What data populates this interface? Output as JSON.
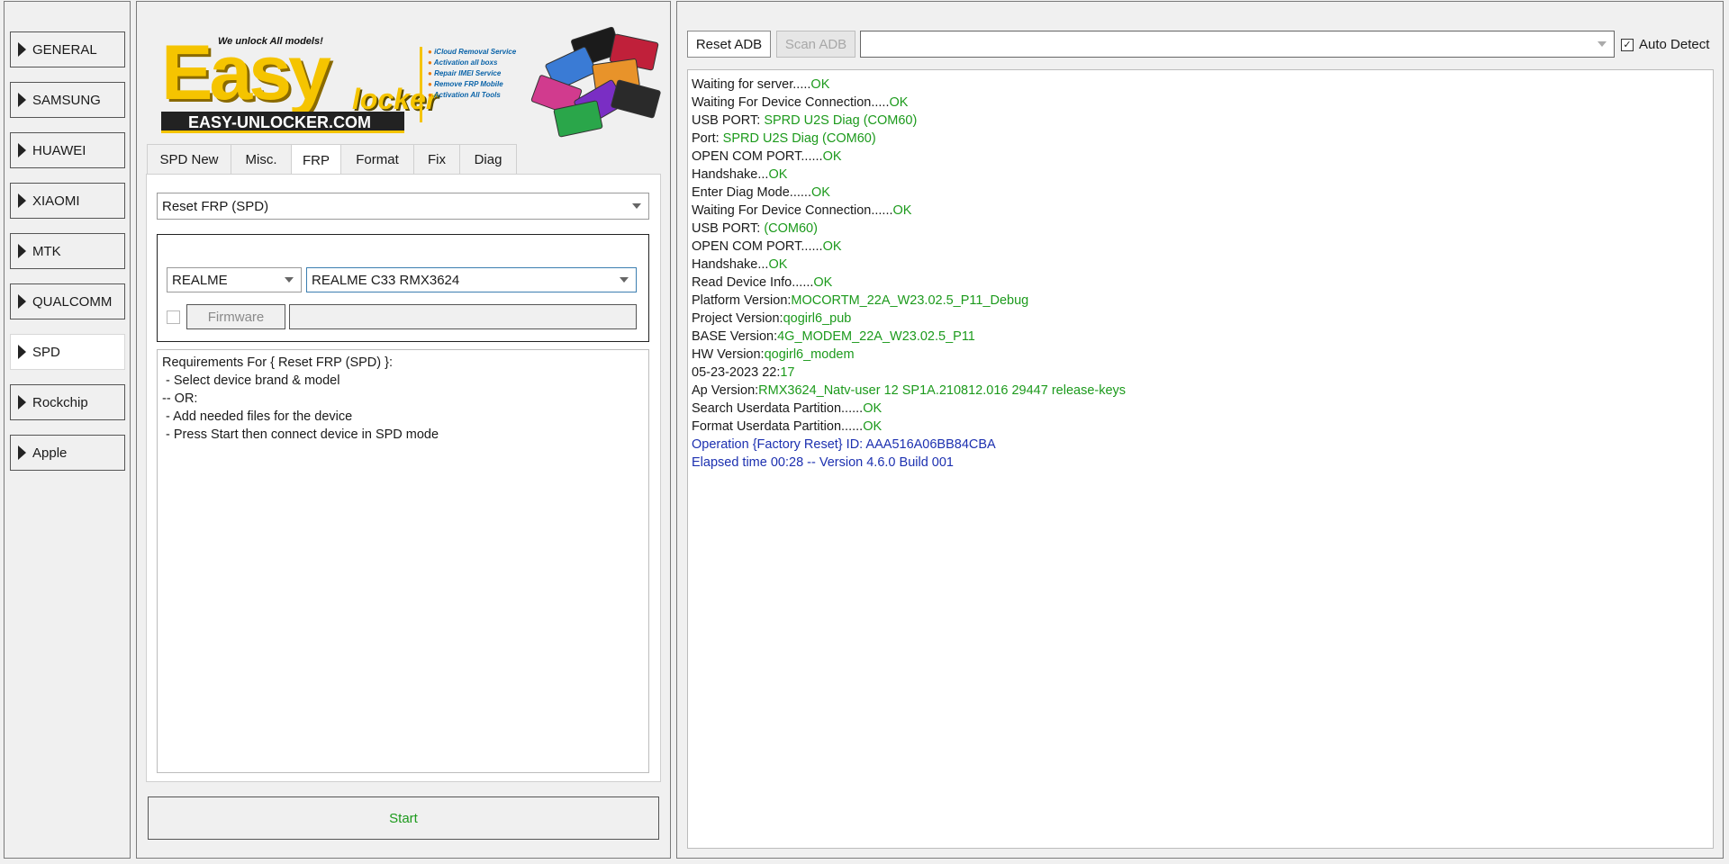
{
  "nav": {
    "items": [
      {
        "label": "GENERAL",
        "active": false
      },
      {
        "label": "SAMSUNG",
        "active": false
      },
      {
        "label": "HUAWEI",
        "active": false
      },
      {
        "label": "XIAOMI",
        "active": false
      },
      {
        "label": "MTK",
        "active": false
      },
      {
        "label": "QUALCOMM",
        "active": false
      },
      {
        "label": "SPD",
        "active": true
      },
      {
        "label": "Rockchip",
        "active": false
      },
      {
        "label": "Apple",
        "active": false
      }
    ]
  },
  "logo": {
    "tagline": "We unlock All models!",
    "brand_easy": "Easy",
    "brand_locker": "locker",
    "domain": "EASY-UNLOCKER.COM",
    "services": [
      "iCloud Removal Service",
      "Activation all boxs",
      "Repair IMEI Service",
      "Remove FRP Mobile",
      "Activation All Tools"
    ]
  },
  "tabs": [
    {
      "label": "SPD New",
      "active": false
    },
    {
      "label": "Misc.",
      "active": false
    },
    {
      "label": "FRP",
      "active": true
    },
    {
      "label": "Format",
      "active": false
    },
    {
      "label": "Fix",
      "active": false
    },
    {
      "label": "Diag",
      "active": false
    }
  ],
  "frp": {
    "operation": "Reset FRP (SPD)",
    "brand": "REALME",
    "model": "REALME C33 RMX3624",
    "firmware_label": "Firmware",
    "firmware_path": "",
    "requirements": "Requirements For { Reset FRP (SPD) }:\n - Select device brand & model\n-- OR:\n - Add needed files for the device\n - Press Start then connect device in SPD mode"
  },
  "start_label": "Start",
  "toolbar": {
    "reset_adb": "Reset ADB",
    "scan_adb": "Scan ADB",
    "device_select": "",
    "auto_detect": "Auto Detect",
    "auto_detect_checked": true
  },
  "log": [
    {
      "prefix": "Waiting for server.....",
      "value": "OK",
      "style": "ok"
    },
    {
      "prefix": "Waiting For Device Connection.....",
      "value": "OK",
      "style": "ok"
    },
    {
      "prefix": "USB PORT: ",
      "value": "SPRD U2S Diag (COM60)",
      "style": "ok"
    },
    {
      "prefix": "Port: ",
      "value": "SPRD U2S Diag (COM60)",
      "style": "ok"
    },
    {
      "prefix": "OPEN COM PORT......",
      "value": "OK",
      "style": "ok"
    },
    {
      "prefix": "Handshake...",
      "value": "OK",
      "style": "ok"
    },
    {
      "prefix": "Enter Diag Mode......",
      "value": "OK",
      "style": "ok"
    },
    {
      "prefix": "Waiting For Device Connection......",
      "value": "OK",
      "style": "ok"
    },
    {
      "prefix": "USB PORT: ",
      "value": "(COM60)",
      "style": "ok"
    },
    {
      "prefix": "OPEN COM PORT......",
      "value": "OK",
      "style": "ok"
    },
    {
      "prefix": "Handshake...",
      "value": "OK",
      "style": "ok"
    },
    {
      "prefix": "Read Device Info......",
      "value": "OK",
      "style": "ok"
    },
    {
      "prefix": "Platform Version:",
      "value": "MOCORTM_22A_W23.02.5_P11_Debug",
      "style": "ok"
    },
    {
      "prefix": "Project Version:",
      "value": "qogirl6_pub",
      "style": "ok"
    },
    {
      "prefix": "BASE Version:",
      "value": "4G_MODEM_22A_W23.02.5_P11",
      "style": "ok"
    },
    {
      "prefix": "HW Version:",
      "value": "qogirl6_modem",
      "style": "ok"
    },
    {
      "prefix": "05-23-2023 22:",
      "value": "17",
      "style": "ok"
    },
    {
      "prefix": "Ap Version:",
      "value": "RMX3624_Natv-user 12 SP1A.210812.016 29447 release-keys",
      "style": "ok"
    },
    {
      "prefix": "Search Userdata Partition......",
      "value": "OK",
      "style": "ok"
    },
    {
      "prefix": "Format Userdata Partition......",
      "value": "OK",
      "style": "ok"
    },
    {
      "prefix": "",
      "value": "Operation {Factory Reset} ID: AAA516A06BB84CBA",
      "style": "blue"
    },
    {
      "prefix": "",
      "value": "Elapsed time 00:28 -- Version 4.6.0 Build 001",
      "style": "blue"
    }
  ]
}
